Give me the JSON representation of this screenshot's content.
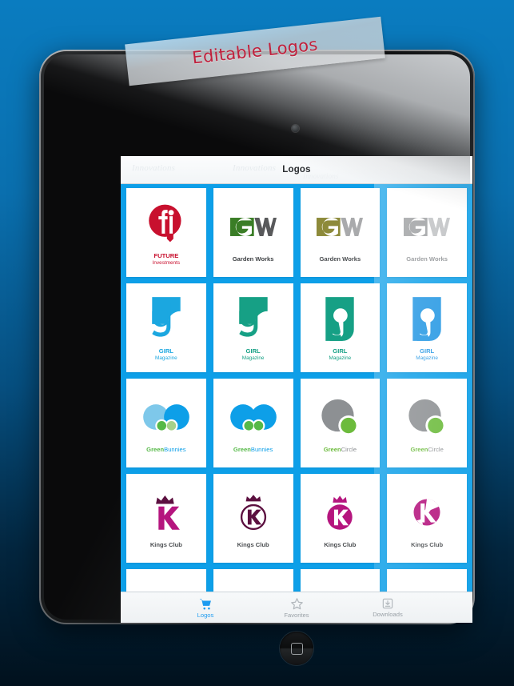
{
  "banner": {
    "text": "Editable Logos",
    "text_color": "#c0203c"
  },
  "device": {
    "name": "tablet",
    "home_button": "home-button",
    "camera": "front-camera"
  },
  "screen": {
    "accent_color": "#0d9fe8",
    "titlebar": {
      "title": "Logos",
      "watermarks": [
        "Innovations",
        "Innovations",
        "Innovations"
      ]
    },
    "cards": [
      {
        "id": 1,
        "brand_line1": "FUTURE",
        "brand_line2": "Investments",
        "mark": "fi-circle-mark",
        "color1": "#c8102e",
        "color2": "#ffffff",
        "caption_color": "#c8102e"
      },
      {
        "id": 2,
        "brand_line1": "Garden Works",
        "brand_line2": "",
        "mark": "gw-block-mark",
        "color1": "#3a7d26",
        "color2": "#58595b",
        "caption_color": "#3c3f42"
      },
      {
        "id": 3,
        "brand_line1": "Garden Works",
        "brand_line2": "",
        "mark": "gw-block-mark",
        "color1": "#8d8a3a",
        "color2": "#a9aaac",
        "caption_color": "#4a4d50"
      },
      {
        "id": 4,
        "brand_line1": "Garden Works",
        "brand_line2": "",
        "mark": "gw-block-mark",
        "color1": "#9a9c9e",
        "color2": "#bfc1c3",
        "caption_color": "#8b8e91"
      },
      {
        "id": 5,
        "brand_line1": "GIRL",
        "brand_line2": "Magazine",
        "mark": "g-panel-mark",
        "color1": "#1ba7e0",
        "color2": "#ffffff",
        "caption_color": "#1ba7e0"
      },
      {
        "id": 6,
        "brand_line1": "GIRL",
        "brand_line2": "Magazine",
        "mark": "g-panel-mark",
        "color1": "#16a085",
        "color2": "#ffffff",
        "caption_color": "#16a085"
      },
      {
        "id": 7,
        "brand_line1": "GIRL",
        "brand_line2": "Magazine",
        "mark": "g-panel-solid-mark",
        "color1": "#16a085",
        "color2": "#ffffff",
        "caption_color": "#16a085"
      },
      {
        "id": 8,
        "brand_line1": "GIRL",
        "brand_line2": "Magazine",
        "mark": "g-panel-solid-mark",
        "color1": "#2196e3",
        "color2": "#ffffff",
        "caption_color": "#2196e3"
      },
      {
        "id": 9,
        "brand_line1": "Green",
        "brand_line2": "Bunnies",
        "mark": "two-circles-mark",
        "color1": "#7ec8ea",
        "color2": "#0d9fe8",
        "color3": "#56b948",
        "color4": "#a6d18a",
        "caption_color": "#56b948",
        "caption_color2": "#0d9fe8"
      },
      {
        "id": 10,
        "brand_line1": "Green",
        "brand_line2": "Bunnies",
        "mark": "two-circles-mark",
        "color1": "#0d9fe8",
        "color2": "#0d9fe8",
        "color3": "#56b948",
        "color4": "#56b948",
        "caption_color": "#56b948",
        "caption_color2": "#0d9fe8"
      },
      {
        "id": 11,
        "brand_line1": "Green",
        "brand_line2": "Circle",
        "mark": "circle-notch-mark",
        "color1": "#8d9093",
        "color2": "#6cbb3c",
        "caption_color": "#6cbb3c",
        "caption_color2": "#8d9093"
      },
      {
        "id": 12,
        "brand_line1": "Green",
        "brand_line2": "Circle",
        "mark": "circle-notch-mark",
        "color1": "#8d9093",
        "color2": "#6cbb3c",
        "caption_color": "#6cbb3c",
        "caption_color2": "#8d9093"
      },
      {
        "id": 13,
        "brand_line1": "Kings Club",
        "brand_line2": "",
        "mark": "crown-k-mark",
        "color1": "#b5157e",
        "color2": "#5c1040",
        "caption_color": "#4a4d50"
      },
      {
        "id": 14,
        "brand_line1": "Kings Club",
        "brand_line2": "",
        "mark": "crown-k-ring-mark",
        "color1": "#5c1040",
        "color2": "#5c1040",
        "caption_color": "#4a4d50"
      },
      {
        "id": 15,
        "brand_line1": "Kings Club",
        "brand_line2": "",
        "mark": "crown-k-disc-mark",
        "color1": "#b5157e",
        "color2": "#ffffff",
        "caption_color": "#4a4d50"
      },
      {
        "id": 16,
        "brand_line1": "Kings Club",
        "brand_line2": "",
        "mark": "k-disc-split-mark",
        "color1": "#b5157e",
        "color2": "#ffffff",
        "caption_color": "#4a4d50"
      },
      {
        "id": 17,
        "brand_line1": "",
        "brand_line2": "",
        "mark": "k-disc-split-mark",
        "color1": "#b5157e",
        "color2": "#ffffff",
        "caption_color": "#4a4d50"
      },
      {
        "id": 18,
        "brand_line1": "",
        "brand_line2": "",
        "mark": "crown-k-disc-mark",
        "color1": "#b5157e",
        "color2": "#ffffff",
        "caption_color": "#4a4d50"
      },
      {
        "id": 19,
        "brand_line1": "",
        "brand_line2": "",
        "mark": "crown-k-mark",
        "color1": "#b5157e",
        "color2": "#5c1040",
        "caption_color": "#4a4d50"
      },
      {
        "id": 20,
        "brand_line1": "",
        "brand_line2": "",
        "mark": "crown-k-mark",
        "color1": "#b5157e",
        "color2": "#5c1040",
        "caption_color": "#4a4d50"
      }
    ],
    "tabbar": {
      "items": [
        {
          "label": "Logos",
          "icon": "cart-icon",
          "active": true
        },
        {
          "label": "Favorites",
          "icon": "star-icon",
          "active": false
        },
        {
          "label": "Downloads",
          "icon": "download-icon",
          "active": false
        }
      ]
    }
  }
}
